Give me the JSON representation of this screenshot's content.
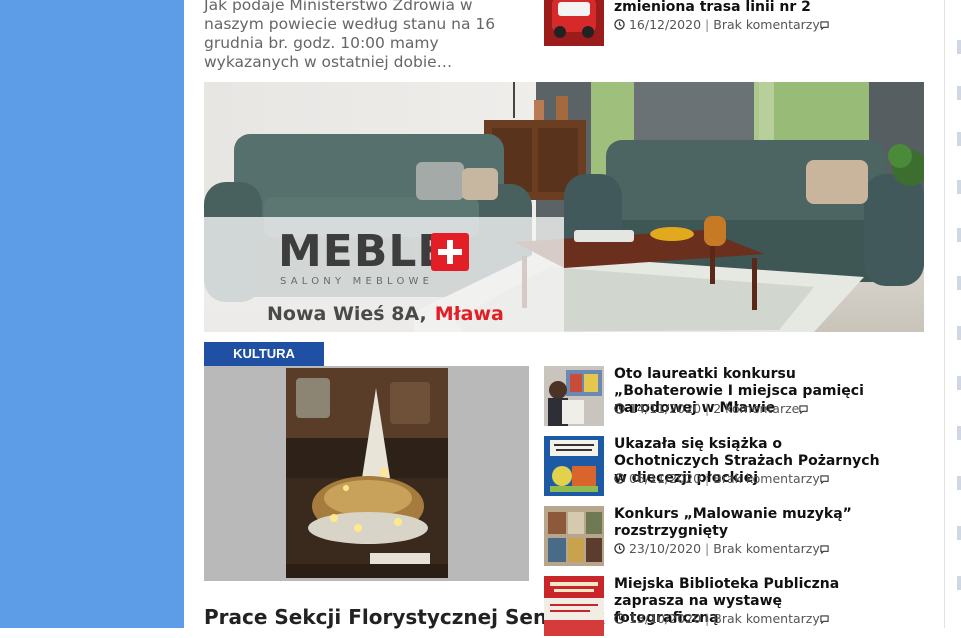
{
  "top": {
    "excerpt": "Jak podaje Ministerstwo Zdrowia w naszym powiecie według stanu na 16 grudnia br. godz. 10:00 mamy wykazanych w ostatniej dobie…",
    "news": {
      "title": "zmieniona trasa linii nr 2",
      "date": "16/12/2020",
      "comments": "Brak komentarzy"
    }
  },
  "ad": {
    "logo": "MEBLE",
    "subtitle": "SALONY MEBLOWE",
    "address": "Nowa Wieś 8A,",
    "city": "Mława"
  },
  "category": {
    "label": "KULTURA",
    "featured_title": "Prace Sekcji Florystycznej Seniorek"
  },
  "articles": [
    {
      "title": "Oto laureatki konkursu „Bohaterowie I miejsca pamięci narodowej w Mławie",
      "date": "14/11/2020",
      "comments": "2 komentarze"
    },
    {
      "title": "Ukazała się książka o Ochotniczych Strażach Pożarnych w diecezji płockiej",
      "date": "06/11/2020",
      "comments": "Brak komentarzy"
    },
    {
      "title": "Konkurs „Malowanie muzyką” rozstrzygnięty",
      "date": "23/10/2020",
      "comments": "Brak komentarzy"
    },
    {
      "title": "Miejska Biblioteka Publiczna zaprasza na wystawę fotograficzną",
      "date": "13/10/2020",
      "comments": "Brak komentarzy"
    }
  ],
  "colors": {
    "side_band": "#5d9de8",
    "category_tag": "#1f50a3",
    "brand_red": "#e21f26"
  }
}
